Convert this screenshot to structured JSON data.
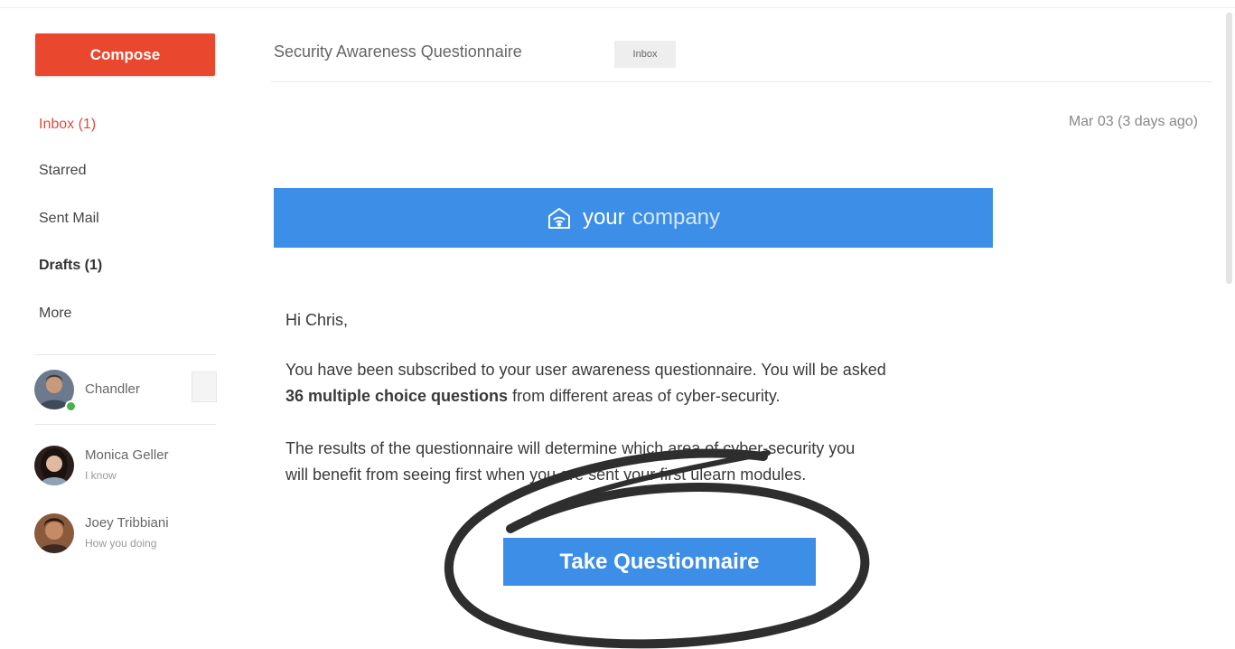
{
  "sidebar": {
    "compose_label": "Compose",
    "nav": [
      {
        "label": "Inbox (1)"
      },
      {
        "label": "Starred"
      },
      {
        "label": "Sent Mail"
      },
      {
        "label": "Drafts (1)"
      },
      {
        "label": "More"
      }
    ],
    "contacts": [
      {
        "name": "Chandler",
        "status": ""
      },
      {
        "name": "Monica Geller",
        "status": "I know"
      },
      {
        "name": "Joey Tribbiani",
        "status": "How you doing"
      }
    ]
  },
  "email": {
    "subject": "Security Awareness Questionnaire",
    "tag": "Inbox",
    "date": "Mar 03 (3 days ago)",
    "banner": {
      "word1": "your",
      "word2": "company"
    },
    "greeting": "Hi Chris,",
    "para1_part1": "You have been subscribed to your user awareness questionnaire. You will be asked",
    "para1_bold": "36 multiple choice questions",
    "para1_part2": " from different areas of cyber-security.",
    "para2_line1": "The results of the questionnaire will determine which area of cyber-security you",
    "para2_line2": "will benefit from seeing first when you are sent your first ulearn modules.",
    "cta_label": "Take Questionnaire"
  },
  "colors": {
    "compose": "#e9472e",
    "accent_blue": "#3d8ee6",
    "inbox_active": "#dd4b39"
  }
}
